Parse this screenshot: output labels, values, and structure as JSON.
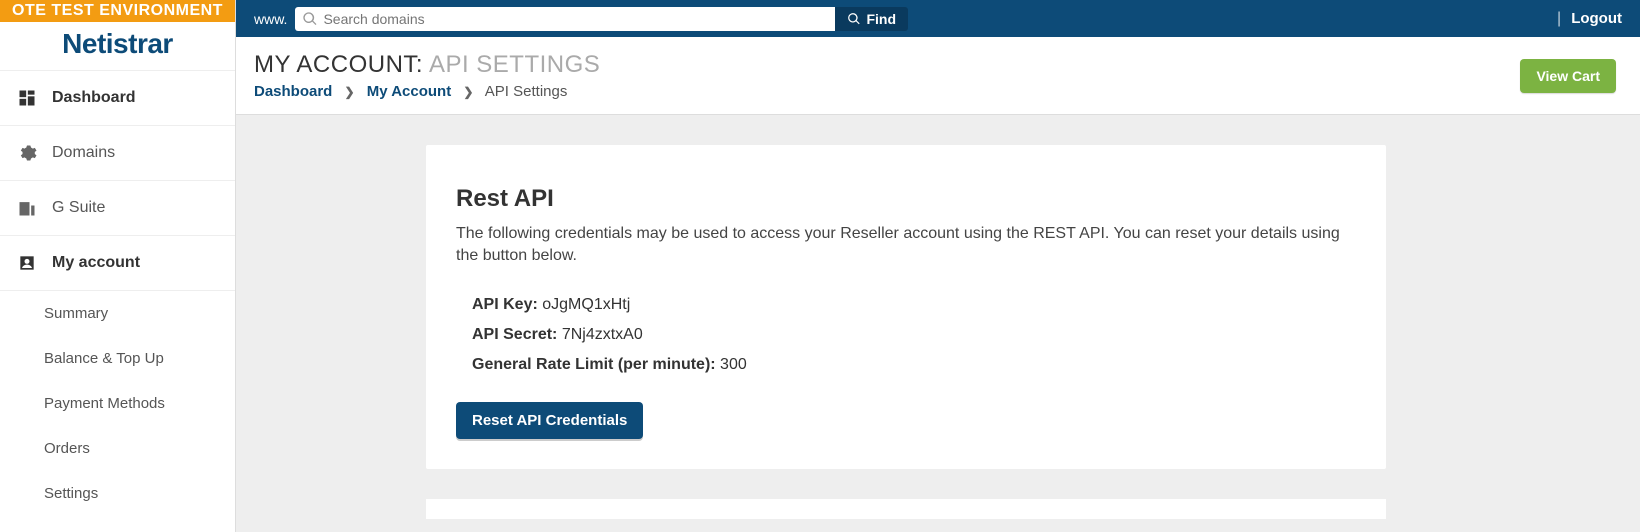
{
  "env_banner": "OTE TEST ENVIRONMENT",
  "brand": "Netistrar",
  "topbar": {
    "www": "www.",
    "search_placeholder": "Search domains",
    "find_label": "Find",
    "logout_label": "Logout"
  },
  "sidebar": {
    "items": [
      {
        "label": "Dashboard",
        "active": true
      },
      {
        "label": "Domains",
        "active": false
      },
      {
        "label": "G Suite",
        "active": false
      },
      {
        "label": "My account",
        "active": true
      }
    ],
    "sub_items": [
      {
        "label": "Summary"
      },
      {
        "label": "Balance & Top Up"
      },
      {
        "label": "Payment Methods"
      },
      {
        "label": "Orders"
      },
      {
        "label": "Settings"
      }
    ]
  },
  "header": {
    "title_main": "MY ACCOUNT:",
    "title_sub": "API SETTINGS",
    "view_cart_label": "View Cart"
  },
  "breadcrumb": {
    "items": [
      {
        "label": "Dashboard",
        "link": true
      },
      {
        "label": "My Account",
        "link": true
      },
      {
        "label": "API Settings",
        "link": false
      }
    ]
  },
  "panel": {
    "heading": "Rest API",
    "description": "The following credentials may be used to access your Reseller account using the REST API. You can reset your details using the button below.",
    "credentials": [
      {
        "label": "API Key:",
        "value": "oJgMQ1xHtj"
      },
      {
        "label": "API Secret:",
        "value": "7Nj4zxtxA0"
      },
      {
        "label": "General Rate Limit (per minute):",
        "value": "300"
      }
    ],
    "reset_label": "Reset API Credentials"
  }
}
